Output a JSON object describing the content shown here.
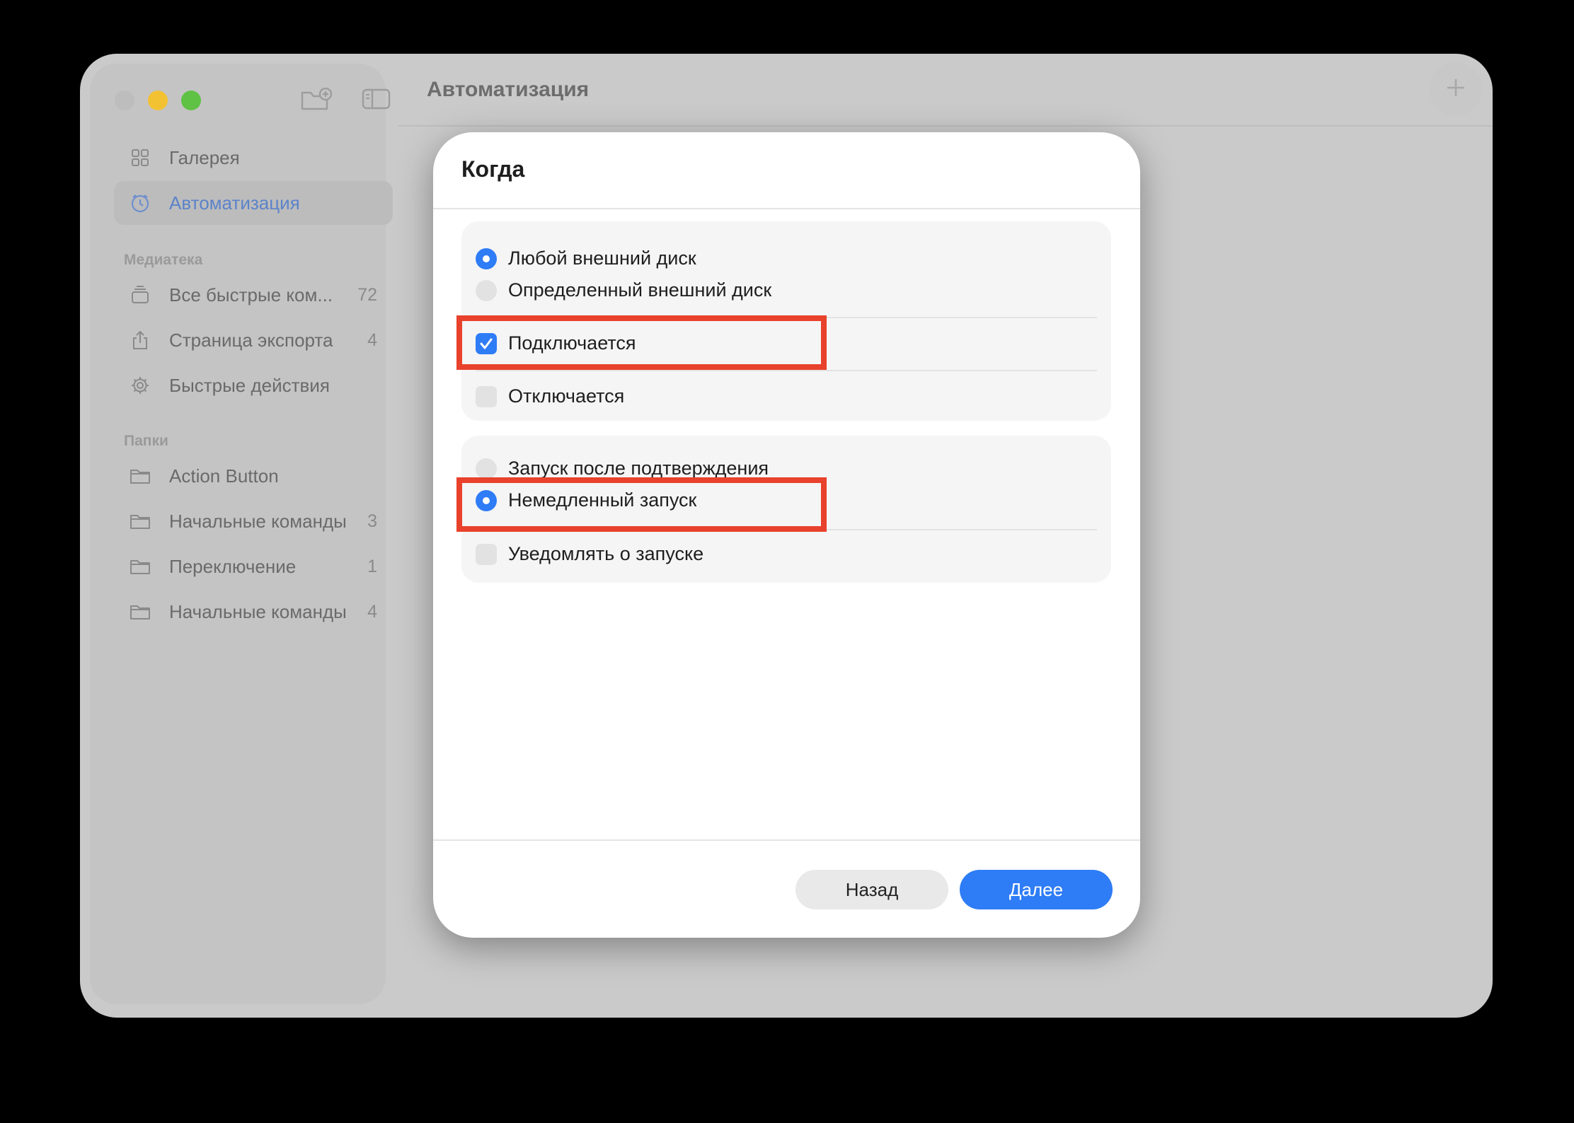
{
  "window": {
    "title": "Автоматизация"
  },
  "sidebar": {
    "items": [
      {
        "label": "Галерея",
        "icon": "grid-icon"
      },
      {
        "label": "Автоматизация",
        "icon": "clock-icon",
        "active": true
      }
    ],
    "library_header": "Медиатека",
    "library": [
      {
        "label": "Все быстрые ком...",
        "count": "72",
        "icon": "stack-icon"
      },
      {
        "label": "Страница экспорта",
        "count": "4",
        "icon": "share-icon"
      },
      {
        "label": "Быстрые действия",
        "count": "",
        "icon": "gear-icon"
      }
    ],
    "folders_header": "Папки",
    "folders": [
      {
        "label": "Action Button",
        "count": ""
      },
      {
        "label": "Начальные команды",
        "count": "3"
      },
      {
        "label": "Переключение",
        "count": "1"
      },
      {
        "label": "Начальные команды",
        "count": "4"
      }
    ]
  },
  "dialog": {
    "title": "Когда",
    "group1": {
      "radio_any": "Любой внешний диск",
      "radio_specific": "Определенный внешний диск",
      "check_connects": "Подключается",
      "check_disconnects": "Отключается"
    },
    "group2": {
      "radio_confirm": "Запуск после подтверждения",
      "radio_immediate": "Немедленный запуск",
      "check_notify": "Уведомлять о запуске"
    },
    "back_button": "Назад",
    "next_button": "Далее"
  },
  "colors": {
    "accent": "#2e7cf6",
    "highlight": "#e8412c"
  }
}
